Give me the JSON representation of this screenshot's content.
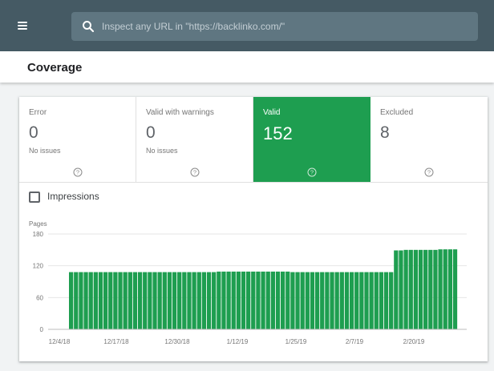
{
  "header": {
    "menu_icon": "hamburger-menu-icon",
    "search_icon": "search-icon",
    "search_placeholder": "Inspect any URL in \"https://backlinko.com/\""
  },
  "page": {
    "title": "Coverage"
  },
  "tabs": [
    {
      "label": "Error",
      "count": "0",
      "sub": "No issues",
      "selected": false
    },
    {
      "label": "Valid with warnings",
      "count": "0",
      "sub": "No issues",
      "selected": false
    },
    {
      "label": "Valid",
      "count": "152",
      "sub": "",
      "selected": true
    },
    {
      "label": "Excluded",
      "count": "8",
      "sub": "",
      "selected": false
    }
  ],
  "impressions": {
    "label": "Impressions",
    "checked": false
  },
  "colors": {
    "header": "#455a64",
    "valid": "#1e9e50",
    "bar": "#1e9e50"
  },
  "chart_data": {
    "type": "bar",
    "ylabel": "Pages",
    "ylim": [
      0,
      180
    ],
    "yticks": [
      "180",
      "120",
      "60",
      "0"
    ],
    "xticks": [
      "12/4/18",
      "12/17/18",
      "12/30/18",
      "1/12/19",
      "1/25/19",
      "2/7/19",
      "2/20/19"
    ],
    "grid": true,
    "values": [
      108,
      108,
      108,
      108,
      108,
      108,
      108,
      108,
      108,
      108,
      108,
      108,
      108,
      108,
      108,
      108,
      108,
      108,
      108,
      108,
      108,
      108,
      108,
      108,
      108,
      108,
      108,
      108,
      108,
      108,
      109,
      109,
      109,
      109,
      109,
      109,
      109,
      109,
      109,
      109,
      109,
      109,
      109,
      109,
      109,
      108,
      108,
      108,
      108,
      108,
      108,
      108,
      108,
      108,
      108,
      108,
      108,
      108,
      108,
      108,
      108,
      108,
      108,
      108,
      108,
      108,
      149,
      149,
      150,
      150,
      150,
      150,
      150,
      150,
      150,
      151,
      151,
      151,
      151
    ]
  }
}
